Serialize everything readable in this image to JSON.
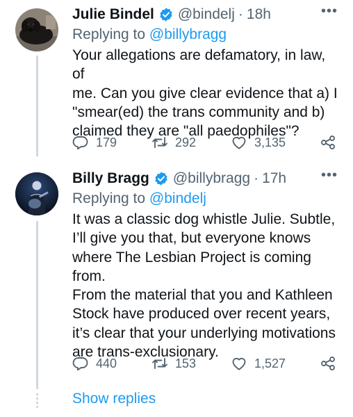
{
  "tweets": [
    {
      "display_name": "Julie Bindel",
      "handle": "@bindelj",
      "separator": "·",
      "time": "18h",
      "more": "•••",
      "replying_prefix": "Replying to",
      "replying_to": "@billybragg",
      "text": "Your allegations are defamatory, in law, of\nme. Can you give clear evidence that a) I\n\"smear(ed) the trans community and b)\nclaimed they are \"all paedophiles\"?",
      "replies": "179",
      "reposts": "292",
      "likes": "3,135",
      "avatar_icon": "dog-avatar"
    },
    {
      "display_name": "Billy Bragg",
      "handle": "@billybragg",
      "separator": "·",
      "time": "17h",
      "more": "•••",
      "replying_prefix": "Replying to",
      "replying_to": "@bindelj",
      "text": "It was a classic dog whistle Julie. Subtle,\nI’ll give you that, but everyone knows\nwhere The Lesbian Project is coming from.\nFrom the material that you and Kathleen\nStock have produced over recent years,\nit’s clear that your underlying motivations\nare trans-exclusionary.",
      "replies": "440",
      "reposts": "153",
      "likes": "1,527",
      "avatar_icon": "guitarist-avatar"
    }
  ],
  "show_replies": "Show replies",
  "colors": {
    "accent": "#1d9bf0",
    "secondary_text": "#536471",
    "thread_line": "#cfd9de"
  }
}
